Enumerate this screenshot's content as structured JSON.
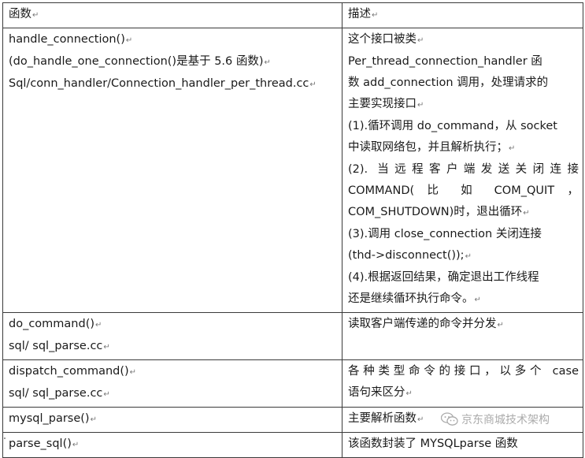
{
  "table": {
    "headers": [
      "函数",
      "描述"
    ],
    "rows": [
      {
        "function_lines": [
          "handle_connection()",
          "(do_handle_one_connection()是基于 5.6 函数)",
          "Sql/conn_handler/Connection_handler_per_thread.cc"
        ],
        "description_lines": [
          "这个接口被类",
          "Per_thread_connection_handler 函",
          "数 add_connection 调用，处理请求的",
          "主要实现接口",
          "(1).循环调用 do_command，从 socket",
          "中读取网络包，并且解析执行；",
          "(2). 当远程客户端发送关闭连接",
          "COMMAND( 比 如  COM_QUIT ，",
          "COM_SHUTDOWN)时，退出循环",
          "(3).调用 close_connection 关闭连接",
          "(thd->disconnect());",
          "(4).根据返回结果，确定退出工作线程",
          "还是继续循环执行命令。"
        ]
      },
      {
        "function_lines": [
          "do_command()",
          "sql/ sql_parse.cc"
        ],
        "description_lines": [
          "读取客户端传递的命令并分发"
        ]
      },
      {
        "function_lines": [
          "dispatch_command()",
          "sql/ sql_parse.cc"
        ],
        "description_lines": [
          "各种类型命令的接口，以多个 case",
          "语句来区分"
        ]
      },
      {
        "function_lines": [
          "mysql_parse()"
        ],
        "description_lines": [
          "主要解析函数"
        ]
      },
      {
        "function_lines": [
          "parse_sql()"
        ],
        "description_lines": [
          "该函数封装了 MYSQLparse 函数"
        ]
      }
    ]
  },
  "paragraph_mark": "↵",
  "watermark": {
    "text": "京东商城技术架构",
    "icon": "wechat-logo-icon"
  },
  "colors": {
    "border": "#3a3a3a",
    "text": "#1a1a1a",
    "watermark": "#8f8f8f"
  }
}
